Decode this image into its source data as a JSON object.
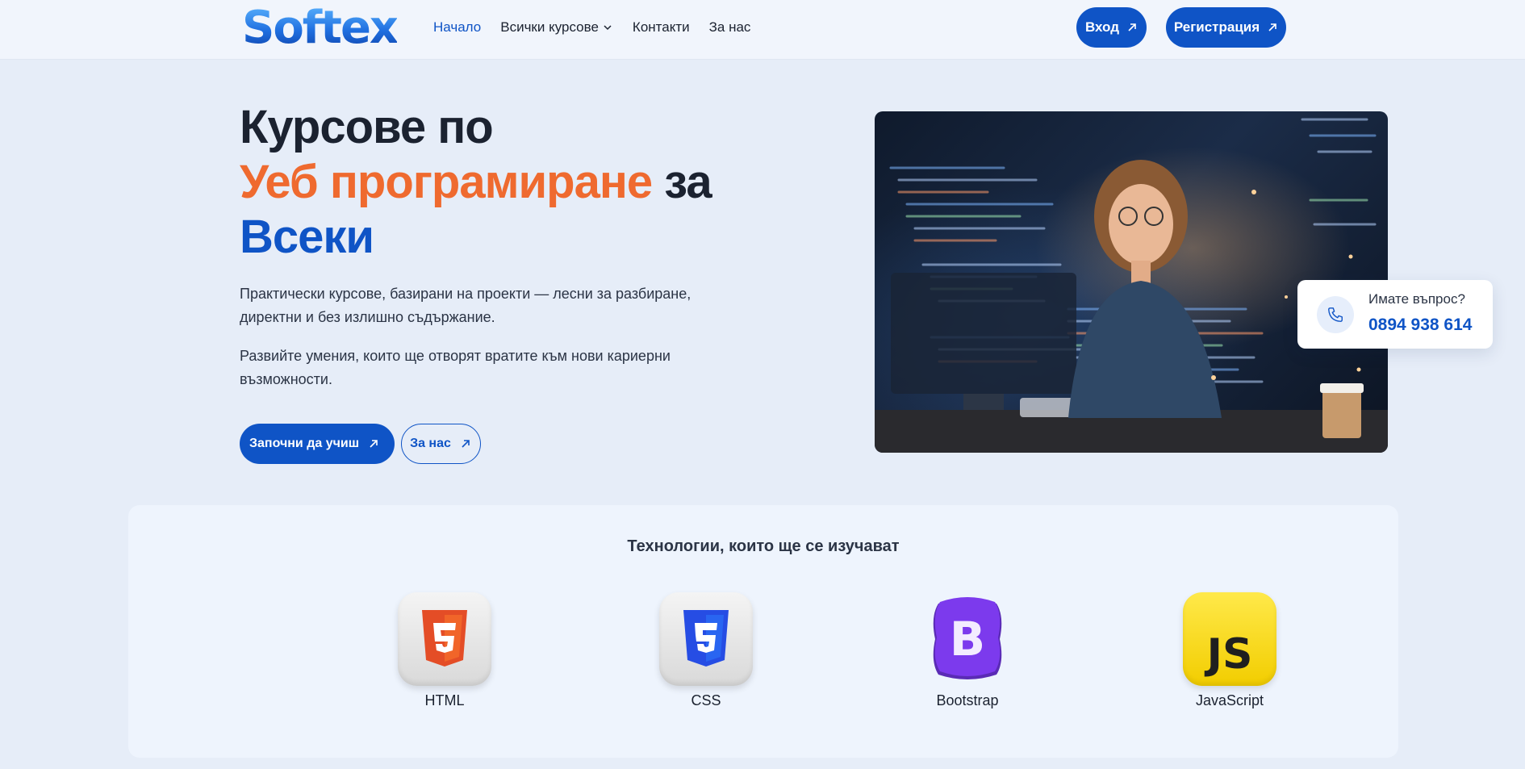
{
  "brand": {
    "logo_text": "Softex"
  },
  "nav": {
    "items": [
      {
        "label": "Начало",
        "active": true
      },
      {
        "label": "Всички курсове",
        "has_dropdown": true
      },
      {
        "label": "Контакти"
      },
      {
        "label": "За нас"
      }
    ],
    "login_label": "Вход",
    "register_label": "Регистрация"
  },
  "hero": {
    "title_line1": "Курсове по",
    "title_highlight": "Уеб програмиране",
    "title_connector": " за",
    "title_line3": "Всеки",
    "paragraph1": "Практически курсове, базирани на проекти — лесни за разбиране, директни и без излишно съдържание.",
    "paragraph2": "Развийте умения, които ще отворят вратите към нови кариерни възможности.",
    "cta_primary": "Започни да учиш",
    "cta_secondary": "За нас"
  },
  "contact_card": {
    "question": "Имате въпрос?",
    "phone": "0894 938 614"
  },
  "technologies": {
    "title": "Технологии, които ще се изучават",
    "items": [
      {
        "name": "HTML",
        "icon": "html5-icon"
      },
      {
        "name": "CSS",
        "icon": "css3-icon"
      },
      {
        "name": "Bootstrap",
        "icon": "bootstrap-icon"
      },
      {
        "name": "JavaScript",
        "icon": "javascript-icon"
      }
    ]
  },
  "colors": {
    "primary": "#0f54c6",
    "accent_orange": "#ef6a2f",
    "background": "#e6edf8",
    "header_bg": "#f1f5fc",
    "text_dark": "#1b2230"
  }
}
